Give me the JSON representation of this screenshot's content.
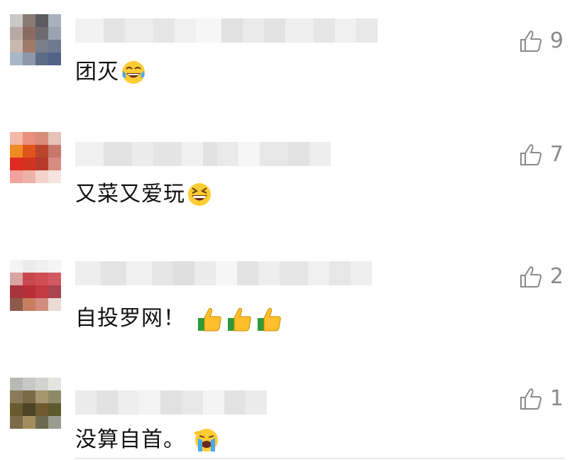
{
  "comments": [
    {
      "text": "团灭",
      "emoji": "tears-of-joy-icon",
      "likes": "9"
    },
    {
      "text": "又菜又爱玩",
      "emoji": "grinning-squinting-icon",
      "likes": "7"
    },
    {
      "text": "自投罗网！",
      "emoji": "thumbs-up-icon",
      "emoji_count": 3,
      "likes": "2"
    },
    {
      "text": "没算自首。",
      "emoji": "loudly-crying-icon",
      "likes": "1"
    }
  ],
  "colors": {
    "like_gray": "#8a8a8a",
    "text": "#111111",
    "divider": "#d7d7d7"
  }
}
